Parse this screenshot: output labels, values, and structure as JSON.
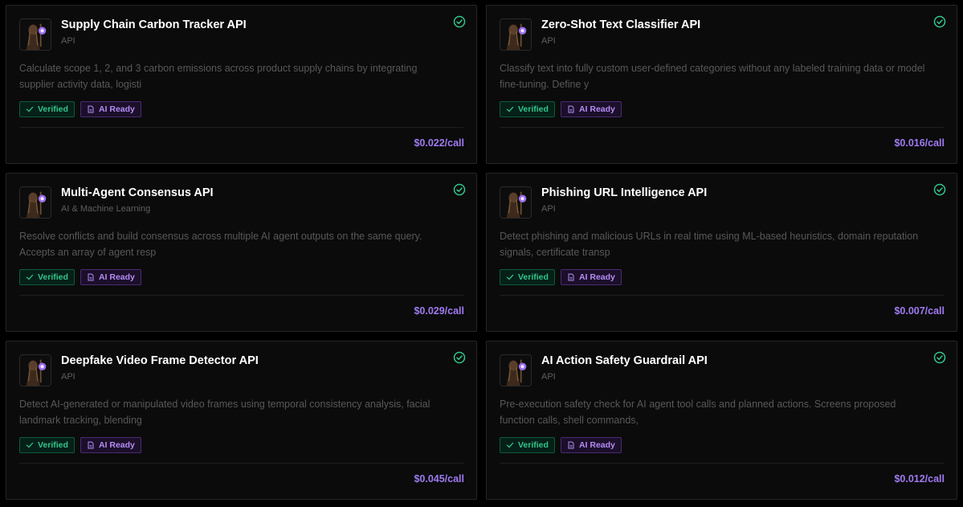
{
  "colors": {
    "accent_price": "#9f7bf2",
    "verified_green": "#33c58a",
    "ai_purple": "#b58cf5",
    "card_bg": "#0b0b0b",
    "card_border": "#262626"
  },
  "badges": {
    "verified_label": "Verified",
    "ai_label": "AI Ready",
    "verified_icon": "checkmark-icon",
    "ai_icon": "document-icon"
  },
  "cards": [
    {
      "title": "Supply Chain Carbon Tracker API",
      "category": "API",
      "description": "Calculate scope 1, 2, and 3 carbon emissions across product supply chains by integrating supplier activity data, logisti",
      "price": "$0.022/call",
      "verified_icon": "check-circle-icon"
    },
    {
      "title": "Zero-Shot Text Classifier API",
      "category": "API",
      "description": "Classify text into fully custom user-defined categories without any labeled training data or model fine-tuning. Define y",
      "price": "$0.016/call",
      "verified_icon": "check-circle-icon"
    },
    {
      "title": "Multi-Agent Consensus API",
      "category": "AI & Machine Learning",
      "description": "Resolve conflicts and build consensus across multiple AI agent outputs on the same query. Accepts an array of agent resp",
      "price": "$0.029/call",
      "verified_icon": "check-circle-icon"
    },
    {
      "title": "Phishing URL Intelligence API",
      "category": "API",
      "description": "Detect phishing and malicious URLs in real time using ML-based heuristics, domain reputation signals, certificate transp",
      "price": "$0.007/call",
      "verified_icon": "check-circle-icon"
    },
    {
      "title": "Deepfake Video Frame Detector API",
      "category": "API",
      "description": "Detect AI-generated or manipulated video frames using temporal consistency analysis, facial landmark tracking, blending",
      "price": "$0.045/call",
      "verified_icon": "check-circle-icon"
    },
    {
      "title": "AI Action Safety Guardrail API",
      "category": "API",
      "description": "Pre-execution safety check for AI agent tool calls and planned actions. Screens proposed function calls, shell commands,",
      "price": "$0.012/call",
      "verified_icon": "check-circle-icon"
    }
  ]
}
